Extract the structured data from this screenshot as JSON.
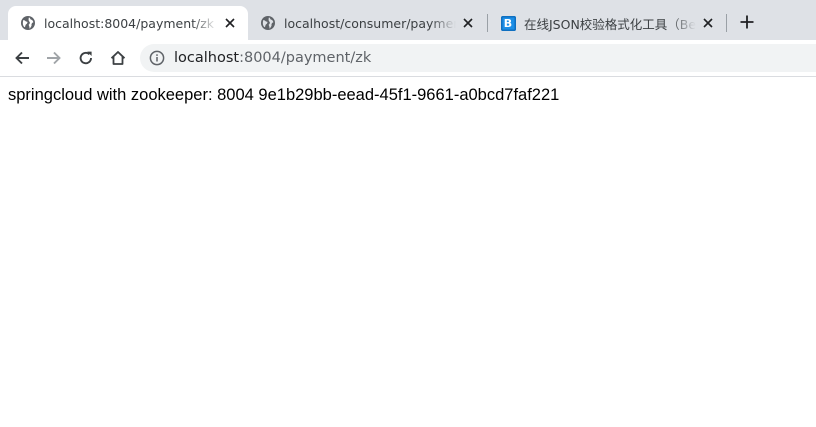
{
  "browser": {
    "tabs": [
      {
        "title": "localhost:8004/payment/zk",
        "active": true,
        "favicon": "globe-icon"
      },
      {
        "title": "localhost/consumer/payment/zk",
        "active": false,
        "favicon": "globe-icon"
      },
      {
        "title": "在线JSON校验格式化工具（Be JSON）",
        "active": false,
        "favicon": "bejson-icon"
      }
    ],
    "favicon_letter_bejson": "B",
    "address": {
      "host": "localhost",
      "rest": ":8004/payment/zk"
    }
  },
  "page": {
    "body_text": "springcloud with zookeeper: 8004 9e1b29bb-eead-45f1-9661-a0bcd7faf221"
  },
  "colors": {
    "tabstrip": "#dee1e6",
    "omnibox": "#f1f3f4",
    "bejson_blue": "#1c8ee6"
  }
}
